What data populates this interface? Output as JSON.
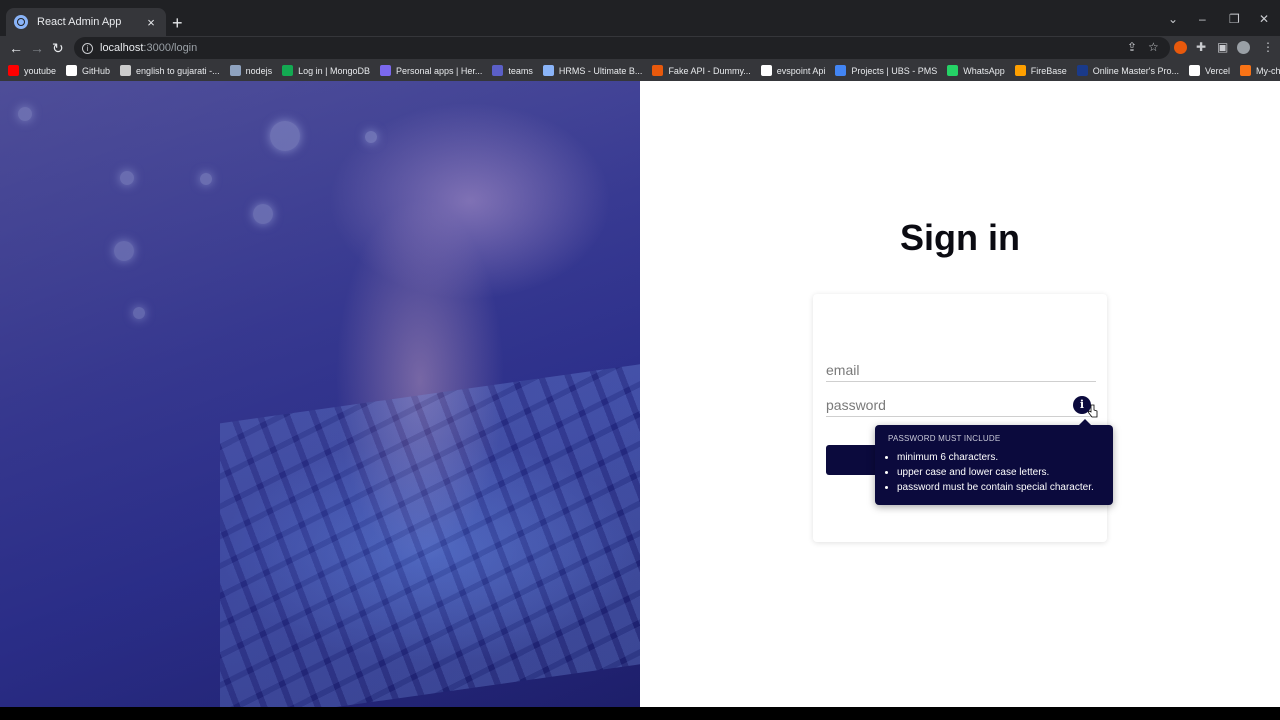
{
  "browser": {
    "tab_title": "React Admin App",
    "tab_close": "×",
    "new_tab": "+",
    "url_host": "localhost",
    "url_rest": ":3000/login",
    "window_controls": {
      "collapse": "⌄",
      "minimize": "–",
      "restore": "❐",
      "close": "✕"
    },
    "nav": {
      "back": "←",
      "forward": "→",
      "reload": "↻"
    },
    "menu": "⋮"
  },
  "bookmarks": [
    {
      "label": "youtube",
      "color": "#ff0000"
    },
    {
      "label": "GitHub",
      "color": "#ffffff"
    },
    {
      "label": "english to gujarati -...",
      "color": "#cccccc"
    },
    {
      "label": "nodejs",
      "color": "#8fa3c0"
    },
    {
      "label": "Log in | MongoDB",
      "color": "#13aa52"
    },
    {
      "label": "Personal apps | Her...",
      "color": "#7b68ee"
    },
    {
      "label": "teams",
      "color": "#5b5fc7"
    },
    {
      "label": "HRMS - Ultimate B...",
      "color": "#8ab4f8"
    },
    {
      "label": "Fake API - Dummy...",
      "color": "#e8590c"
    },
    {
      "label": "evspoint Api",
      "color": "#ffffff"
    },
    {
      "label": "Projects | UBS - PMS",
      "color": "#4285f4"
    },
    {
      "label": "WhatsApp",
      "color": "#25d366"
    },
    {
      "label": "FireBase",
      "color": "#ffa000"
    },
    {
      "label": "Online Master's Pro...",
      "color": "#1a3a8a"
    },
    {
      "label": "Vercel",
      "color": "#ffffff"
    },
    {
      "label": "My-chats",
      "color": "#f97316"
    }
  ],
  "login": {
    "title": "Sign in",
    "email_placeholder": "email",
    "password_placeholder": "password",
    "info_icon": "i",
    "button_label": ""
  },
  "tooltip": {
    "title": "PASSWORD MUST INCLUDE",
    "items": [
      "minimum 6 characters.",
      "upper case and lower case letters.",
      "password must be contain special character."
    ]
  },
  "colors": {
    "accent": "#0b0a3d",
    "hero_tint": "#2b2f8c"
  }
}
